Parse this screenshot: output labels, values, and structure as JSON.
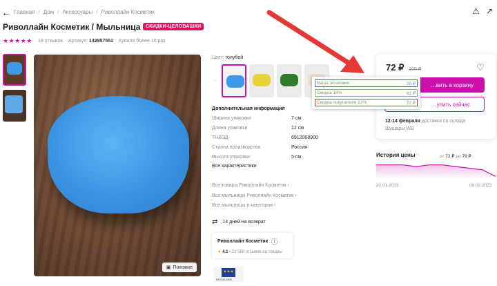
{
  "breadcrumb": [
    "Главная",
    "Дом",
    "Аксессуары",
    "Риволлайн Косметик"
  ],
  "product": {
    "title": "Риволлайн Косметик / Мыльница",
    "promo": "СКИДКИ-ЦЕЛОВАШКИ",
    "stars": "★★★★★",
    "rating_value": 5,
    "reviews": "16 отзывов",
    "article_label": "Артикул:",
    "article": "142957551",
    "bought": "Купили более 10 раз"
  },
  "gallery": {
    "similar_label": "Похожие"
  },
  "color": {
    "label": "Цвет:",
    "value": "голубой",
    "swatches": [
      "#3d9ae6",
      "#e8d43a",
      "#2f7a2b",
      "#f1e8dc"
    ]
  },
  "specs": {
    "heading": "Дополнительная информация",
    "rows": [
      {
        "name": "Ширина упаковки",
        "value": "7 см"
      },
      {
        "name": "Длина упаковки",
        "value": "12 см"
      },
      {
        "name": "ТНВЭД",
        "value": "6912008900"
      },
      {
        "name": "Страна производства",
        "value": "Россия"
      },
      {
        "name": "Высота упаковки",
        "value": "5 см"
      }
    ],
    "all_label": "Все характеристики"
  },
  "links": [
    "Все товары Риволлайн Косметик ›",
    "Все мыльницы Риволлайн Косметик ›",
    "Все мыльницы в категории ›"
  ],
  "returns": "14 дней на возврат",
  "brand": {
    "name": "Риволлайн Косметик",
    "rating": "4.1",
    "reviews": "• 22 588 отзывов на товары",
    "logo_text": "RIVOLLAINE"
  },
  "price": {
    "current": "72 ₽",
    "old": "100 ₽",
    "cart_label": "…вить в корзину",
    "buy_label": "…упить сейчас",
    "delivery_date": "12-14 февраля",
    "delivery_text": "доставка со склада",
    "warehouse": "Шушары WB"
  },
  "tooltip": [
    {
      "label": "Ваша экономия",
      "value": "28 ₽"
    },
    {
      "label": "Скидка 18%",
      "value": "82 ₽"
    },
    {
      "label": "Скидка покупателя 12%",
      "value": "72 ₽"
    }
  ],
  "history": {
    "title": "История цены",
    "range_from_label": "от",
    "range_from": "72 ₽",
    "range_to_label": "до",
    "range_to": "79 ₽",
    "date_start": "22.01.2023",
    "date_end": "09.02.2023",
    "points": [
      79,
      79,
      79,
      78,
      79,
      79,
      78,
      77,
      76,
      72
    ]
  },
  "colors": {
    "accent": "#cb11ab",
    "promo": "#e0115f",
    "arrow": "#e53935",
    "box_blue": "#3f6fcf",
    "box_green": "#7cc243",
    "box_red": "#e02b27"
  }
}
